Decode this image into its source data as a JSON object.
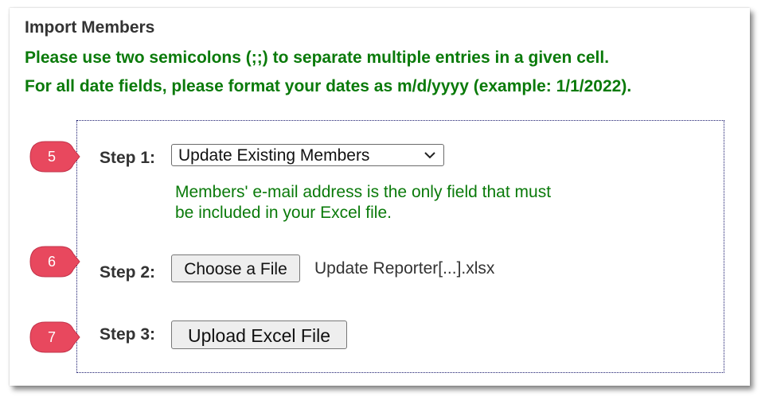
{
  "header": {
    "title": "Import Members",
    "instructions": [
      "Please use two semicolons (;;) to separate multiple entries in a given cell.",
      "For all date fields, please format your dates as m/d/yyyy (example: 1/1/2022)."
    ]
  },
  "steps": [
    {
      "marker": "5",
      "label": "Step 1:",
      "select_value": "Update Existing Members",
      "note_line1": "Members' e-mail address is the only field that must",
      "note_line2": "be included in your Excel file."
    },
    {
      "marker": "6",
      "label": "Step 2:",
      "button_label": "Choose a File",
      "file_name": "Update Reporter[...].xlsx"
    },
    {
      "marker": "7",
      "label": "Step 3:",
      "button_label": "Upload Excel File"
    }
  ],
  "colors": {
    "instruction_green": "#0a7a0a",
    "marker_red": "#e8485e",
    "box_border": "#1a1a6e"
  },
  "icons": {
    "select_arrow": "chevron-down-icon",
    "step_marker": "callout-marker-icon"
  }
}
